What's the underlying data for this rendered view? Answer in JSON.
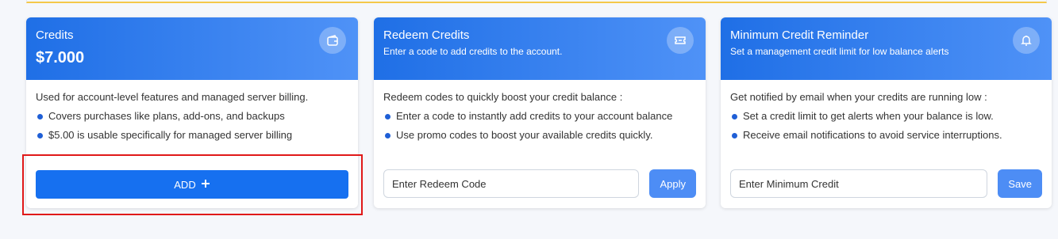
{
  "credits_card": {
    "title": "Credits",
    "amount": "$7.000",
    "icon": "wallet-icon",
    "intro": "Used for account-level features and managed server billing.",
    "bullets": [
      "Covers purchases like plans, add-ons, and backups",
      "$5.00 is usable specifically for managed server billing"
    ],
    "add_label": "ADD",
    "add_icon": "plus-icon"
  },
  "redeem_card": {
    "title": "Redeem Credits",
    "subtitle": "Enter a code to add credits to the account.",
    "icon": "ticket-icon",
    "intro": "Redeem codes to quickly boost your credit balance :",
    "bullets": [
      "Enter a code to instantly add credits to your account balance",
      "Use promo codes to boost your available credits quickly."
    ],
    "input_placeholder": "Enter Redeem Code",
    "button_label": "Apply"
  },
  "reminder_card": {
    "title": "Minimum Credit Reminder",
    "subtitle": "Set a management credit limit for low balance alerts",
    "icon": "bell-icon",
    "intro": "Get notified by email when your credits are running low :",
    "bullets": [
      "Set a credit limit to get alerts when your balance is low.",
      "Receive email notifications to avoid service interruptions."
    ],
    "input_placeholder": "Enter Minimum Credit",
    "button_label": "Save"
  },
  "colors": {
    "header_start": "#1f6fe6",
    "header_end": "#4f92f7",
    "primary_button": "#1670f0",
    "secondary_button": "#4d8df5",
    "highlight": "#e01919"
  }
}
